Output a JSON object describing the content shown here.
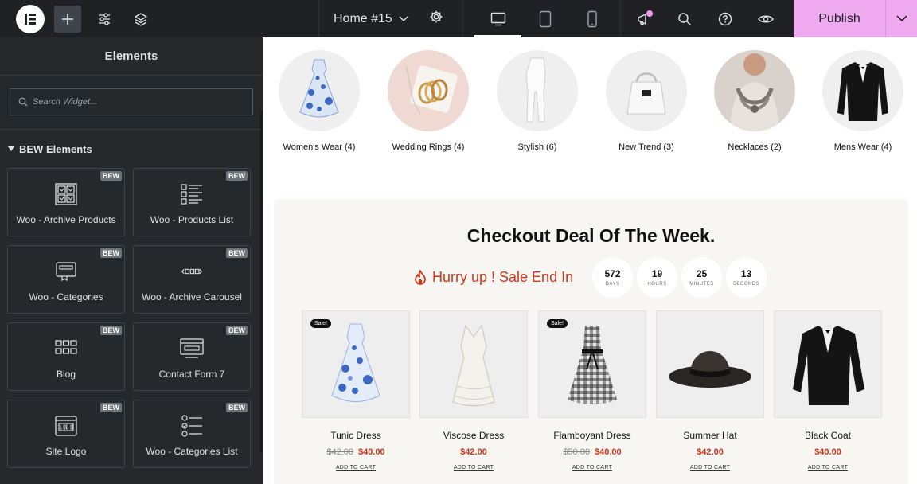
{
  "topbar": {
    "page_title": "Home #15",
    "publish_label": "Publish",
    "colors": {
      "bar": "#1f2124",
      "publish": "#f0abf0",
      "notification": "#f09be6"
    }
  },
  "sidebar": {
    "title": "Elements",
    "search_placeholder": "Search Widget...",
    "category": "BEW Elements",
    "badge": "BEW",
    "widgets": [
      {
        "label": "Woo - Archive Products",
        "icon": "archive-products-icon"
      },
      {
        "label": "Woo - Products List",
        "icon": "products-list-icon"
      },
      {
        "label": "Woo - Categories",
        "icon": "categories-icon"
      },
      {
        "label": "Woo - Archive Carousel",
        "icon": "carousel-icon"
      },
      {
        "label": "Blog",
        "icon": "blog-grid-icon"
      },
      {
        "label": "Contact Form 7",
        "icon": "contact-form-icon"
      },
      {
        "label": "Site Logo",
        "icon": "site-logo-icon"
      },
      {
        "label": "Woo - Categories List",
        "icon": "categories-list-icon"
      }
    ]
  },
  "canvas": {
    "categories": [
      {
        "label": "Women's Wear (4)"
      },
      {
        "label": "Wedding Rings (4)"
      },
      {
        "label": "Stylish (6)"
      },
      {
        "label": "New Trend (3)"
      },
      {
        "label": "Necklaces (2)"
      },
      {
        "label": "Mens Wear (4)"
      }
    ],
    "deal": {
      "title": "Checkout Deal Of The Week.",
      "hurry_text": "Hurry up ! Sale End In",
      "counters": [
        {
          "value": "572",
          "unit": "DAYS"
        },
        {
          "value": "19",
          "unit": "HOURS"
        },
        {
          "value": "25",
          "unit": "MINUTES"
        },
        {
          "value": "13",
          "unit": "SECONDS"
        }
      ],
      "sale_badge": "Sale!",
      "add_to_cart": "ADD TO CART",
      "products": [
        {
          "name": "Tunic Dress",
          "old_price": "$42.00",
          "price": "$40.00",
          "on_sale": true
        },
        {
          "name": "Viscose Dress",
          "old_price": "",
          "price": "$42.00",
          "on_sale": false
        },
        {
          "name": "Flamboyant Dress",
          "old_price": "$50.00",
          "price": "$40.00",
          "on_sale": true
        },
        {
          "name": "Summer Hat",
          "old_price": "",
          "price": "$42.00",
          "on_sale": false
        },
        {
          "name": "Black Coat",
          "old_price": "",
          "price": "$40.00",
          "on_sale": false
        }
      ]
    },
    "colors": {
      "accent": "#c83a1f",
      "deal_bg": "#f7f6f2"
    }
  }
}
